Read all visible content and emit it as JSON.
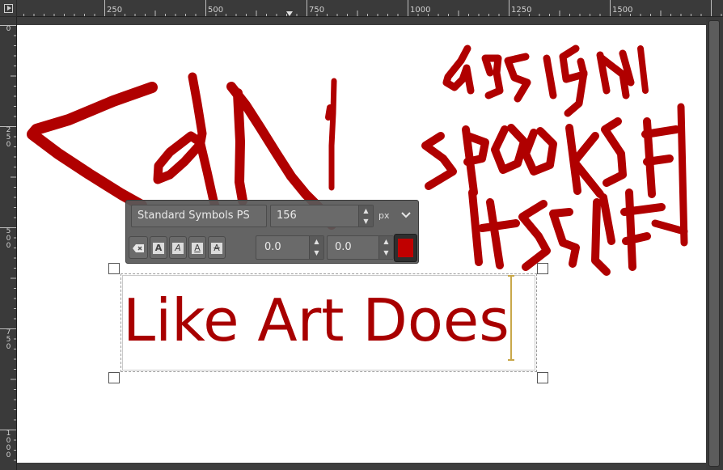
{
  "rulers": {
    "horizontal": [
      "250",
      "500",
      "750",
      "1000",
      "1250",
      "1500"
    ],
    "vertical": [
      "0",
      "250",
      "500",
      "750",
      "1000"
    ]
  },
  "canvas": {
    "layer_text": "Like Art Does",
    "drawing_color": "#b00000",
    "scribbles": [
      "Can",
      "design",
      "speaks",
      "itself"
    ]
  },
  "text_tool": {
    "font_name": "Standard Symbols PS",
    "font_size": "156",
    "size_unit": "px",
    "baseline_offset": "0.0",
    "kerning": "0.0",
    "text_color": "#c00000",
    "buttons": [
      "clear-style",
      "bold",
      "italic",
      "underline",
      "strikethrough"
    ]
  },
  "icons": {
    "unit_dropdown": "chevron-down-icon",
    "clear": "clear-style-icon",
    "corner": "navigation-icon"
  }
}
